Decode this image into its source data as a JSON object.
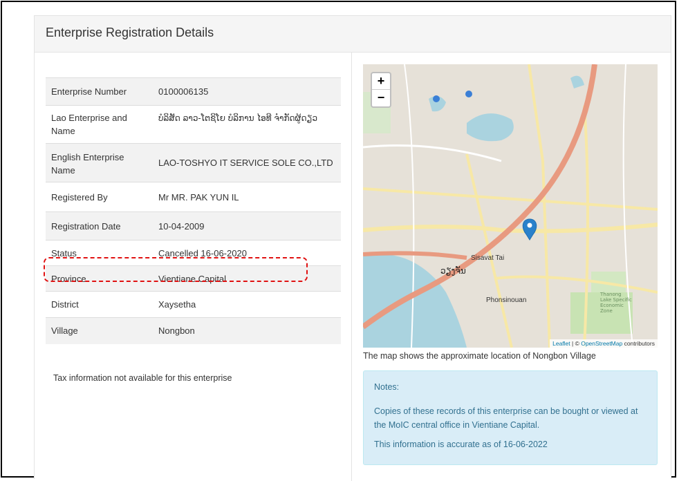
{
  "panel": {
    "title": "Enterprise Registration Details"
  },
  "details": {
    "rows": [
      {
        "label": "Enterprise Number",
        "value": "0100006135"
      },
      {
        "label": "Lao Enterprise and Name",
        "value": "ບໍລິສັດ ລາວ-ໂຕຊິໂຍ ບໍລິການ ໄອທີ ຈຳກັດຜູ້ດຽວ"
      },
      {
        "label": "English Enterprise Name",
        "value": "LAO-TOSHYO IT SERVICE SOLE CO.,LTD"
      },
      {
        "label": "Registered By",
        "value": "Mr MR. PAK YUN IL"
      },
      {
        "label": "Registration Date",
        "value": "10-04-2009"
      },
      {
        "label": "Status",
        "value": "Cancelled 16-06-2020"
      },
      {
        "label": "Province",
        "value": "Vientiane Capital"
      },
      {
        "label": "District",
        "value": "Xaysetha"
      },
      {
        "label": "Village",
        "value": "Nongbon"
      }
    ],
    "tax_note": "Tax information not available for this enterprise"
  },
  "map": {
    "zoom_in": "+",
    "zoom_out": "−",
    "attribution_leaflet": "Leaflet",
    "attribution_sep": " | © ",
    "attribution_osm": "OpenStreetMap",
    "attribution_contrib": " contributors",
    "labels": {
      "sisavat_tai": "Sisavat Tai",
      "phonsinouan": "Phonsinouan",
      "vientiane_lao": "ວຽງຈັນ",
      "thanong": "Thanong\nLake Specific\nEconomic\nZone"
    },
    "caption": "The map shows the approximate location of Nongbon Village",
    "colors": {
      "water": "#aad3df",
      "land": "#e6e1d8",
      "main_road": "#e89a80",
      "secondary_road": "#f7e8a6",
      "marker": "#2a81cb"
    }
  },
  "notes": {
    "title": "Notes:",
    "para1": "Copies of these records of this enterprise can be bought or viewed at the MoIC central office in Vientiane Capital.",
    "para2": "This information is accurate as of 16-06-2022"
  }
}
